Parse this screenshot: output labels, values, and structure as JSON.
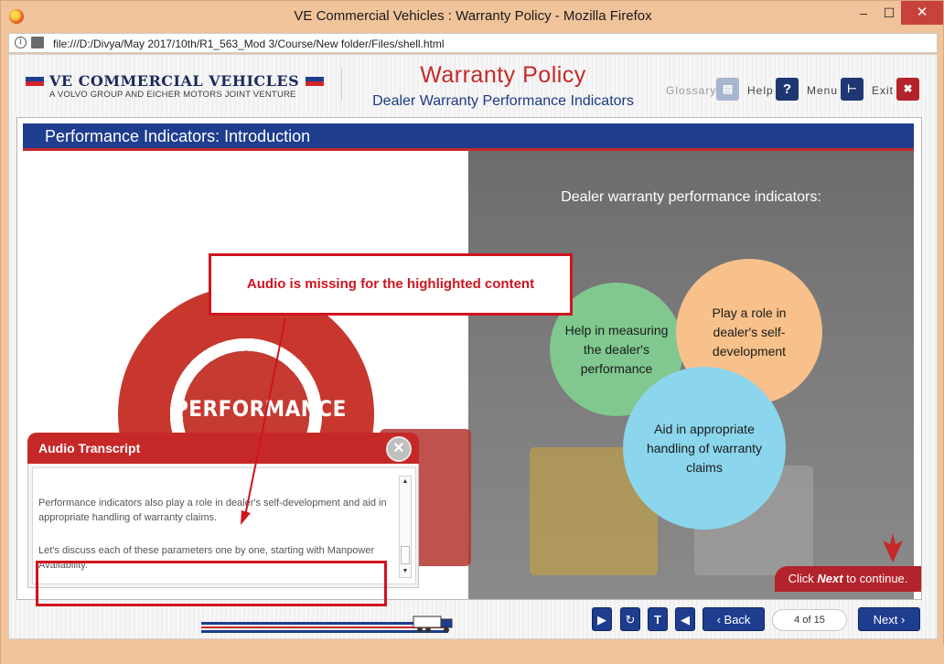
{
  "window": {
    "title": "VE Commercial Vehicles : Warranty Policy - Mozilla Firefox",
    "min": "–",
    "max": "☐",
    "close": "✕"
  },
  "address": {
    "url": "file:///D:/Divya/May 2017/10th/R1_563_Mod 3/Course/New folder/Files/shell.html",
    "info_icon": "i"
  },
  "brand": {
    "name": "VE COMMERCIAL VEHICLES",
    "tagline": "A VOLVO GROUP AND EICHER MOTORS JOINT VENTURE",
    "colors": {
      "blue": "#1e3d8e",
      "red": "#c62828"
    }
  },
  "course": {
    "title": "Warranty Policy",
    "subtitle": "Dealer Warranty Performance Indicators"
  },
  "toolbar": {
    "glossary": "Glossary",
    "help": "Help",
    "help_icon": "?",
    "menu": "Menu",
    "exit": "Exit",
    "exit_icon": "✖"
  },
  "slide": {
    "title": "Performance Indicators: Introduction",
    "badge_word": "PERFORMANCE",
    "indicators_title": "Dealer warranty performance indicators:",
    "circles": [
      {
        "label": "Help in measuring the dealer's performance",
        "color": "#80c88f"
      },
      {
        "label": "Play a role in dealer's self-development",
        "color": "#f8c08a"
      },
      {
        "label": "Aid in appropriate handling of warranty claims",
        "color": "#8bd6ec"
      }
    ],
    "continue_prefix": "Click ",
    "continue_next": "Next",
    "continue_suffix": " to continue."
  },
  "callout": {
    "text": "Audio is missing for the highlighted content"
  },
  "transcript": {
    "title": "Audio Transcript",
    "close_icon": "✕",
    "paragraphs": [
      "Performance indicators also play a role in dealer's self-development and aid in appropriate handling of warranty claims.",
      "Let's discuss each of these parameters one by one, starting with Manpower Availability."
    ],
    "scroll_up": "▲",
    "scroll_down": "▼"
  },
  "nav": {
    "play_icon": "▶",
    "replay_icon": "↻",
    "text_icon": "T",
    "audio_icon": "◀",
    "back_label": "‹ Back",
    "page": "4 of 15",
    "next_label": "Next ›"
  }
}
